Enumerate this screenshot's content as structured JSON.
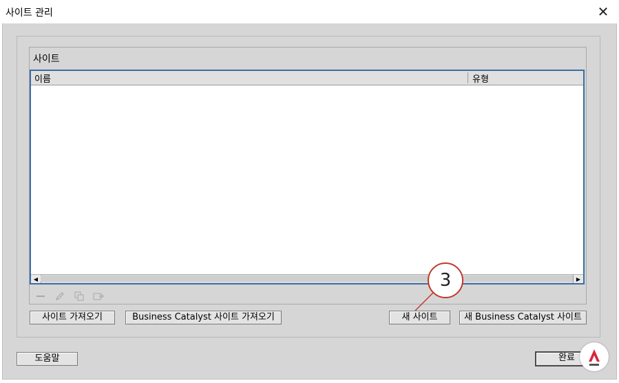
{
  "window": {
    "title": "사이트 관리",
    "close_glyph": "✕"
  },
  "sites_group": {
    "label": "사이트",
    "columns": {
      "name": "이름",
      "type": "유형"
    }
  },
  "toolbar_icons": [
    "minus-icon",
    "pencil-icon",
    "duplicate-icon",
    "export-icon"
  ],
  "buttons": {
    "import_sites": "사이트 가져오기",
    "import_bc_sites": "Business Catalyst 사이트 가져오기",
    "new_site": "새 사이트",
    "new_bc_site": "새 Business Catalyst 사이트",
    "help": "도움말",
    "done": "완료"
  },
  "annotation": {
    "step": "3",
    "color": "#c0392b"
  },
  "colors": {
    "list_border": "#3a6ea5",
    "dialog_bg": "#d6d6d6"
  }
}
